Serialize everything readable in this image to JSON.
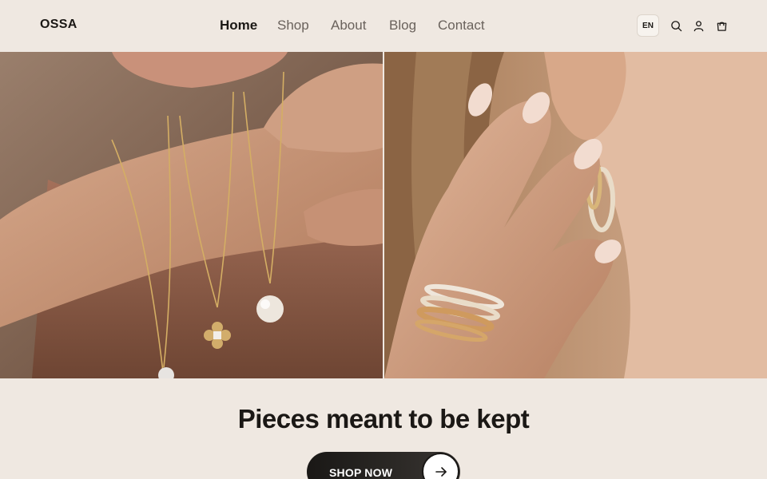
{
  "brand": {
    "logo": "OSSA"
  },
  "nav": {
    "items": [
      {
        "label": "Home",
        "active": true
      },
      {
        "label": "Shop",
        "active": false
      },
      {
        "label": "About",
        "active": false
      },
      {
        "label": "Blog",
        "active": false
      },
      {
        "label": "Contact",
        "active": false
      }
    ]
  },
  "header_actions": {
    "language": "EN",
    "icons": [
      "search-icon",
      "user-icon",
      "cart-icon"
    ]
  },
  "hero": {
    "images": [
      {
        "name": "necklaces-photo",
        "depicts": "hand with gold chain necklaces and pendants"
      },
      {
        "name": "rings-earrings-photo",
        "depicts": "hand with stacked gold rings and hoop earrings"
      }
    ]
  },
  "content": {
    "headline": "Pieces meant to be kept",
    "cta_label": "SHOP NOW",
    "cta_icon": "arrow-right-icon"
  },
  "colors": {
    "background": "#efe8e1",
    "text": "#1b1815",
    "nav_muted": "#6a625c",
    "cta": "#1a1816"
  }
}
